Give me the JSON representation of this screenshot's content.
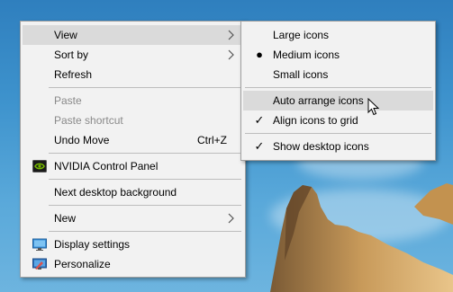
{
  "context_menu": {
    "items": [
      {
        "label": "View"
      },
      {
        "label": "Sort by"
      },
      {
        "label": "Refresh"
      },
      {
        "label": "Paste"
      },
      {
        "label": "Paste shortcut"
      },
      {
        "label": "Undo Move",
        "shortcut": "Ctrl+Z"
      },
      {
        "label": "NVIDIA Control Panel"
      },
      {
        "label": "Next desktop background"
      },
      {
        "label": "New"
      },
      {
        "label": "Display settings"
      },
      {
        "label": "Personalize"
      }
    ]
  },
  "view_submenu": {
    "items": [
      {
        "label": "Large icons"
      },
      {
        "label": "Medium icons",
        "selected": true
      },
      {
        "label": "Small icons"
      },
      {
        "label": "Auto arrange icons",
        "checked": false
      },
      {
        "label": "Align icons to grid",
        "checked": true
      },
      {
        "label": "Show desktop icons",
        "checked": true
      }
    ]
  },
  "colors": {
    "menu_background": "#f2f2f2",
    "highlight": "#dadada",
    "disabled_text": "#8a8a8a",
    "nvidia_green": "#76b900"
  },
  "icons": {
    "submenu_arrow": "chevron-right-icon",
    "radio_selected": "bullet-icon",
    "checkbox_checked": "checkmark-icon"
  }
}
